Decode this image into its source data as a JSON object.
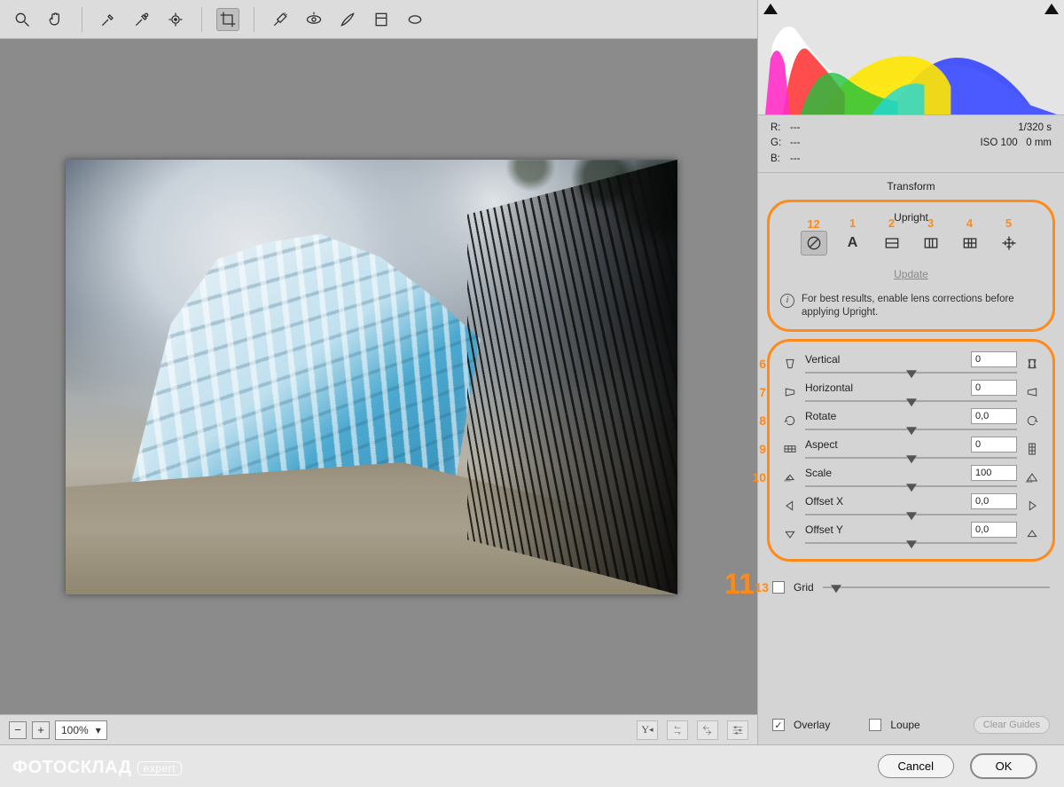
{
  "toolbar": {
    "icons": [
      "zoom",
      "hand",
      "eyedropper",
      "color-sampler",
      "target-adjust",
      "crop",
      "spot-heal",
      "redeye",
      "brush",
      "grad",
      "radial"
    ],
    "active": "crop"
  },
  "zoom": {
    "minus": "−",
    "plus": "+",
    "value": "100%"
  },
  "histogram_meta": {
    "r_label": "R:",
    "r_val": "---",
    "g_label": "G:",
    "g_val": "---",
    "b_label": "B:",
    "b_val": "---",
    "shutter": "1/320 s",
    "iso": "ISO 100",
    "focal": "0 mm"
  },
  "panel": {
    "section": "Transform",
    "upright_label": "Upright",
    "upright_numbers": [
      "12",
      "1",
      "2",
      "3",
      "4",
      "5"
    ],
    "update": "Update",
    "hint": "For best results, enable lens corrections before applying Upright."
  },
  "sliders": [
    {
      "num": "6",
      "label": "Vertical",
      "value": "0",
      "pos": 50,
      "iconL": "persp-v-l",
      "iconR": "persp-v-r"
    },
    {
      "num": "7",
      "label": "Horizontal",
      "value": "0",
      "pos": 50,
      "iconL": "persp-h-l",
      "iconR": "persp-h-r"
    },
    {
      "num": "8",
      "label": "Rotate",
      "value": "0,0",
      "pos": 50,
      "iconL": "rot-ccw",
      "iconR": "rot-cw"
    },
    {
      "num": "9",
      "label": "Aspect",
      "value": "0",
      "pos": 50,
      "iconL": "grid-wide",
      "iconR": "grid-tall"
    },
    {
      "num": "10",
      "label": "Scale",
      "value": "100",
      "pos": 50,
      "iconL": "scale-sm",
      "iconR": "scale-lg"
    },
    {
      "num": "",
      "label": "Offset X",
      "value": "0,0",
      "pos": 50,
      "iconL": "arr-l",
      "iconR": "arr-r"
    },
    {
      "num": "",
      "label": "Offset Y",
      "value": "0,0",
      "pos": 50,
      "iconL": "arr-d",
      "iconR": "arr-u"
    }
  ],
  "annot_11": "11",
  "grid": {
    "num": "13",
    "label": "Grid",
    "checked": false
  },
  "overlay": {
    "overlay_label": "Overlay",
    "overlay_checked": true,
    "loupe_label": "Loupe",
    "loupe_checked": false,
    "clear": "Clear Guides"
  },
  "footer": {
    "cancel": "Cancel",
    "ok": "OK"
  },
  "watermark": {
    "brand": "ФОТОСКЛАД",
    "tag": "expert"
  }
}
